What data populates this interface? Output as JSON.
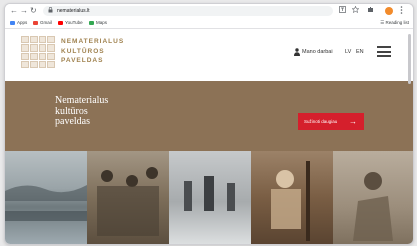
{
  "browser": {
    "url": "nematerialus.lt",
    "back_glyph": "←",
    "forward_glyph": "→",
    "reload_glyph": "↻",
    "lock_glyph": "🔒",
    "icons": [
      "translate-icon",
      "star-icon",
      "extension-icon",
      "profile-icon",
      "menu-icon"
    ]
  },
  "bookmarks": [
    {
      "label": "Apps",
      "color": "#4285f4"
    },
    {
      "label": "Gmail",
      "color": "#ea4335"
    },
    {
      "label": "YouTube",
      "color": "#ff0000"
    },
    {
      "label": "Maps",
      "color": "#34a853"
    }
  ],
  "reading_list": "Reading list",
  "site": {
    "logo_lines": [
      "NEMATERIALUS",
      "KULTŪROS",
      "PAVELDAS"
    ],
    "user_link": "Mano darbai",
    "lang_lv": "LV",
    "lang_en": "EN"
  },
  "hero": {
    "title_lines": [
      "Nematerialus",
      "kultūros",
      "paveldas"
    ],
    "button_label": "Sužinoti daugiau",
    "button_arrow": "→",
    "bg_color": "#8c7256",
    "button_color": "#d51f2c"
  },
  "photos": [
    {
      "name": "photo-river-crowd",
      "tone": "#7d8a90"
    },
    {
      "name": "photo-folk-group",
      "tone": "#8b7c66"
    },
    {
      "name": "photo-winter-procession",
      "tone": "#9a9da0"
    },
    {
      "name": "photo-weaver",
      "tone": "#8a6d50"
    },
    {
      "name": "photo-musician",
      "tone": "#a99a88"
    }
  ]
}
